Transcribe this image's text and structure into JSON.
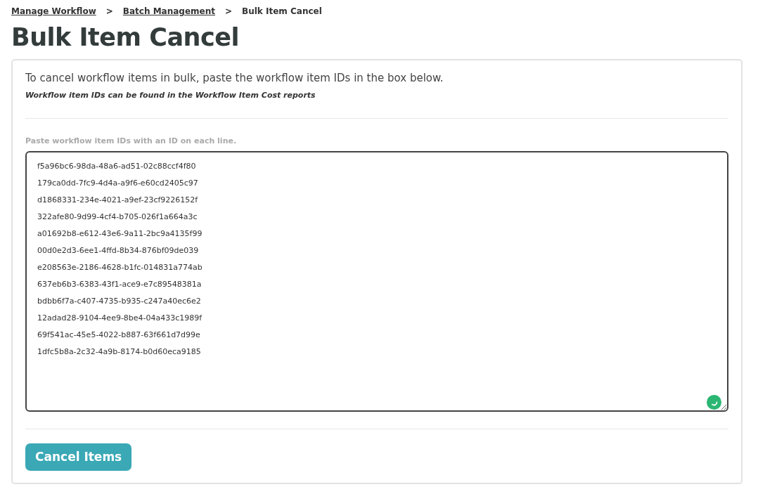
{
  "breadcrumb": [
    {
      "label": "Manage Workflow",
      "kind": "link"
    },
    {
      "label": "Batch Management",
      "kind": "link"
    },
    {
      "label": "Bulk Item Cancel",
      "kind": "current"
    }
  ],
  "breadcrumb_separator": ">",
  "title": "Bulk Item Cancel",
  "intro": "To cancel workflow items in bulk, paste the workflow item IDs in the box below.",
  "note": "Workflow item IDs can be found in the Workflow Item Cost reports",
  "field": {
    "label": "Paste workflow item IDs with an ID on each line.",
    "lines": [
      "f5a96bc6-98da-48a6-ad51-02c88ccf4f80",
      "179ca0dd-7fc9-4d4a-a9f6-e60cd2405c97",
      "d1868331-234e-4021-a9ef-23cf9226152f",
      "322afe80-9d99-4cf4-b705-026f1a664a3c",
      "a01692b8-e612-43e6-9a11-2bc9a4135f99",
      "00d0e2d3-6ee1-4ffd-8b34-876bf09de039",
      "e208563e-2186-4628-b1fc-014831a774ab",
      "637eb6b3-6383-43f1-ace9-e7c89548381a",
      "bdbb6f7a-c407-4735-b935-c247a40ec6e2",
      "12adad28-9104-4ee9-8be4-04a433c1989f",
      "69f541ac-45e5-4022-b887-63f661d7d99e",
      "1dfc5b8a-2c32-4a9b-8174-b0d60eca9185"
    ]
  },
  "button": "Cancel Items"
}
